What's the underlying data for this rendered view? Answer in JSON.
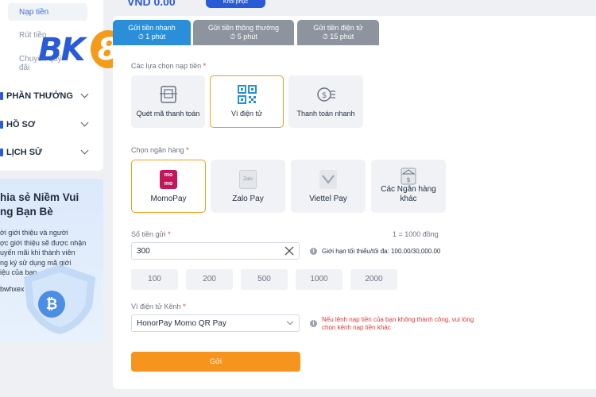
{
  "sidebar": {
    "sub_items": [
      "Nạp tiền",
      "Rút tiền",
      "Chuyển quỹ",
      "đãi"
    ],
    "logo_text": "BK8",
    "nav": [
      {
        "label": "PHẦN THƯỞNG",
        "icon": "gift-icon"
      },
      {
        "label": "HỒ SƠ",
        "icon": "profile-icon"
      },
      {
        "label": "LỊCH SỬ",
        "icon": "history-icon"
      }
    ],
    "promo": {
      "title_line1": "hia sẻ Niềm Vui",
      "title_line2": "ng Bạn Bè",
      "text_lines": [
        "ời giới thiệu và người",
        "ợc giới thiệu sẽ được nhận",
        "uyến mãi khi thành viên",
        "ng ký sử dụng mã giới",
        "iệu của bạn"
      ],
      "code": "bwhxex"
    }
  },
  "header": {
    "balance": "VND 0.00",
    "restore_label": "Khôi phục"
  },
  "tabs": [
    {
      "label": "Gửi tiền nhanh",
      "time": "1 phút",
      "active": true
    },
    {
      "label": "Gửi tiền thông thường",
      "time": "5 phút",
      "active": false
    },
    {
      "label": "Gửi tiền điện tử",
      "time": "15 phút",
      "active": false
    }
  ],
  "deposit_options": {
    "label": "Các lựa chọn nạp tiền",
    "items": [
      {
        "label": "Quét mã thanh toán",
        "icon": "qr-scan-icon",
        "selected": false
      },
      {
        "label": "Ví điện tử",
        "icon": "qr-code-icon",
        "selected": true
      },
      {
        "label": "Thanh toán nhanh",
        "icon": "fast-payment-icon",
        "selected": false
      }
    ]
  },
  "banks": {
    "label": "Chọn ngân hàng",
    "items": [
      {
        "label": "MomoPay",
        "icon": "momo-icon",
        "selected": true
      },
      {
        "label": "Zalo Pay",
        "icon": "zalopay-icon",
        "selected": false
      },
      {
        "label": "Viettel Pay",
        "icon": "viettelpay-icon",
        "selected": false
      },
      {
        "label": "Các Ngân hàng khác",
        "icon": "bank-icon",
        "selected": false
      }
    ]
  },
  "amount": {
    "label": "Số tiền gửi",
    "rate": "1 = 1000 đồng",
    "value": "300",
    "limit": "Giới hạn tối thiểu/tối đa: 100.00/30,000.00",
    "quick": [
      "100",
      "200",
      "500",
      "1000",
      "2000"
    ]
  },
  "channel": {
    "label": "Ví điện tử Kênh",
    "value": "HonorPay Momo QR Pay",
    "warning": "Nếu lệnh nạp tiền của bạn không thành công, vui lòng chọn kênh nạp tiền khác"
  },
  "submit_label": "Gửi",
  "colors": {
    "accent": "#2a8fd8",
    "brand_blue": "#2a5bd7",
    "orange": "#f7941d",
    "error": "#e53935"
  }
}
